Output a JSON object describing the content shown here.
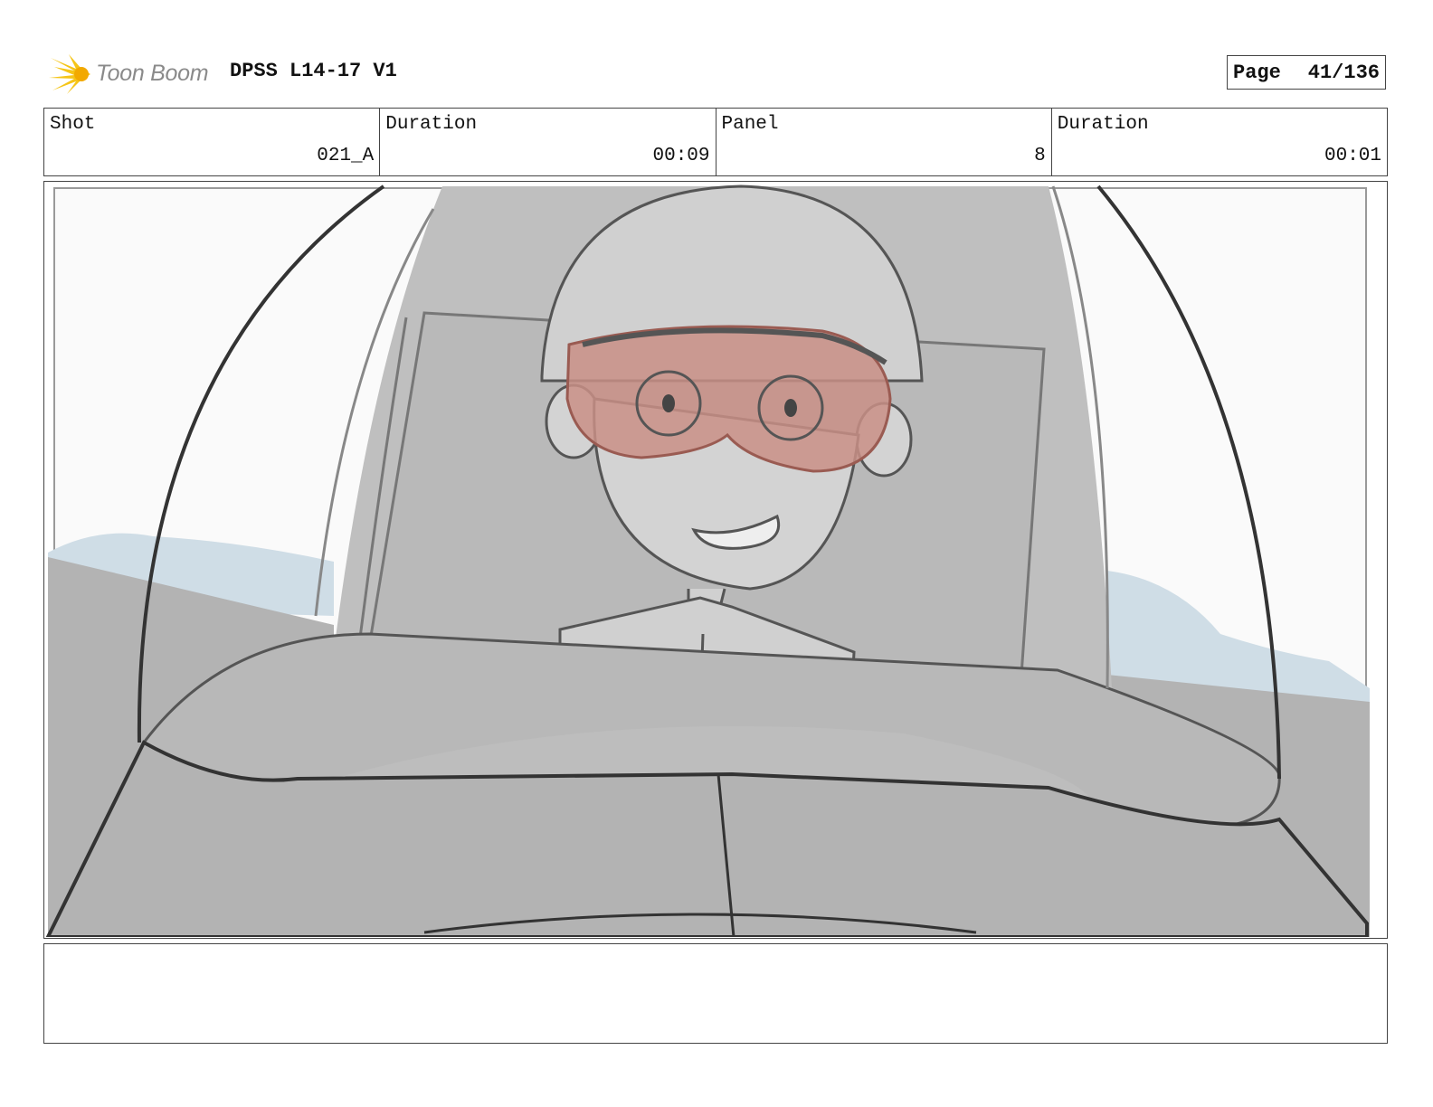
{
  "header": {
    "logo_text": "Toon Boom",
    "project_title": "DPSS L14-17 V1",
    "page_label": "Page",
    "page_number": "41/136"
  },
  "info": {
    "shot_label": "Shot",
    "shot_value": "021_A",
    "shot_duration_label": "Duration",
    "shot_duration_value": "00:09",
    "panel_label": "Panel",
    "panel_value": "8",
    "panel_duration_label": "Duration",
    "panel_duration_value": "00:01"
  },
  "notes": {
    "text": ""
  },
  "colors": {
    "logo_accent": "#f5c518",
    "goggles": "#c98f86",
    "sky_blue": "#cfdde6",
    "border": "#444444"
  }
}
